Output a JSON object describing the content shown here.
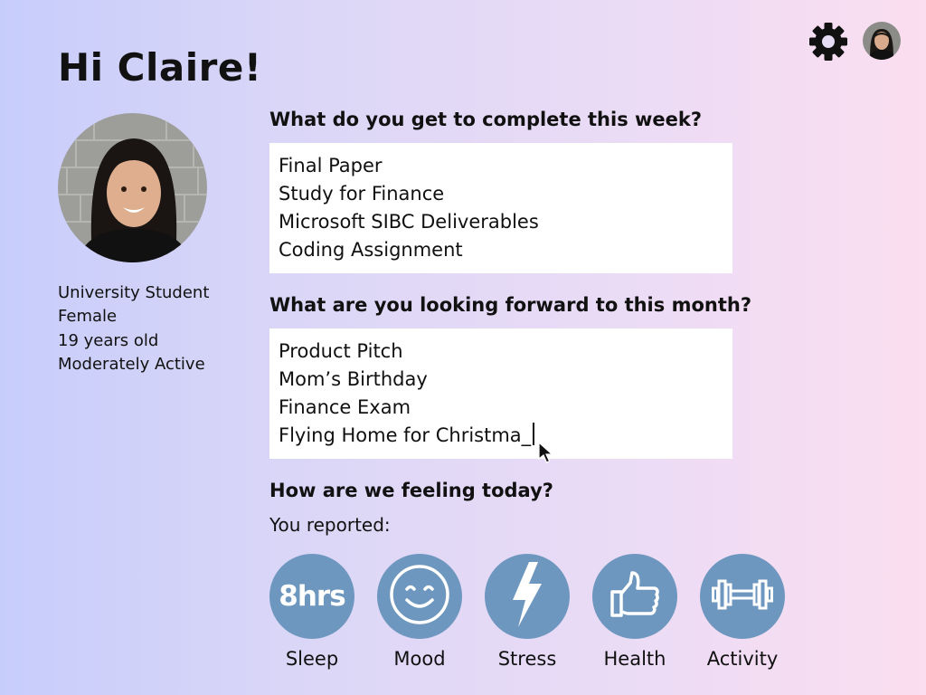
{
  "header": {
    "greeting": "Hi Claire!"
  },
  "profile": {
    "details": [
      "University Student",
      "Female",
      "19 years old",
      "Moderately Active"
    ]
  },
  "questions": {
    "week": {
      "label": "What do you get to complete this week?",
      "answer": "Final Paper\nStudy for Finance\nMicrosoft SIBC Deliverables\nCoding Assignment"
    },
    "month": {
      "label": "What are you looking forward to this month?",
      "answer": "Product Pitch\nMom’s Birthday\nFinance Exam\nFlying Home for Christma_"
    },
    "feeling": {
      "label": "How are we feeling today?",
      "reported": "You reported:"
    }
  },
  "metrics": [
    {
      "label": "Sleep",
      "value": "8hrs",
      "icon": "sleep-value"
    },
    {
      "label": "Mood",
      "icon": "smiley-icon"
    },
    {
      "label": "Stress",
      "icon": "lightning-bolt-icon"
    },
    {
      "label": "Health",
      "icon": "thumbs-up-icon"
    },
    {
      "label": "Activity",
      "icon": "dumbbell-icon"
    }
  ],
  "colors": {
    "metric_circle": "#6e97bf",
    "text": "#111111",
    "box": "#ffffff"
  }
}
